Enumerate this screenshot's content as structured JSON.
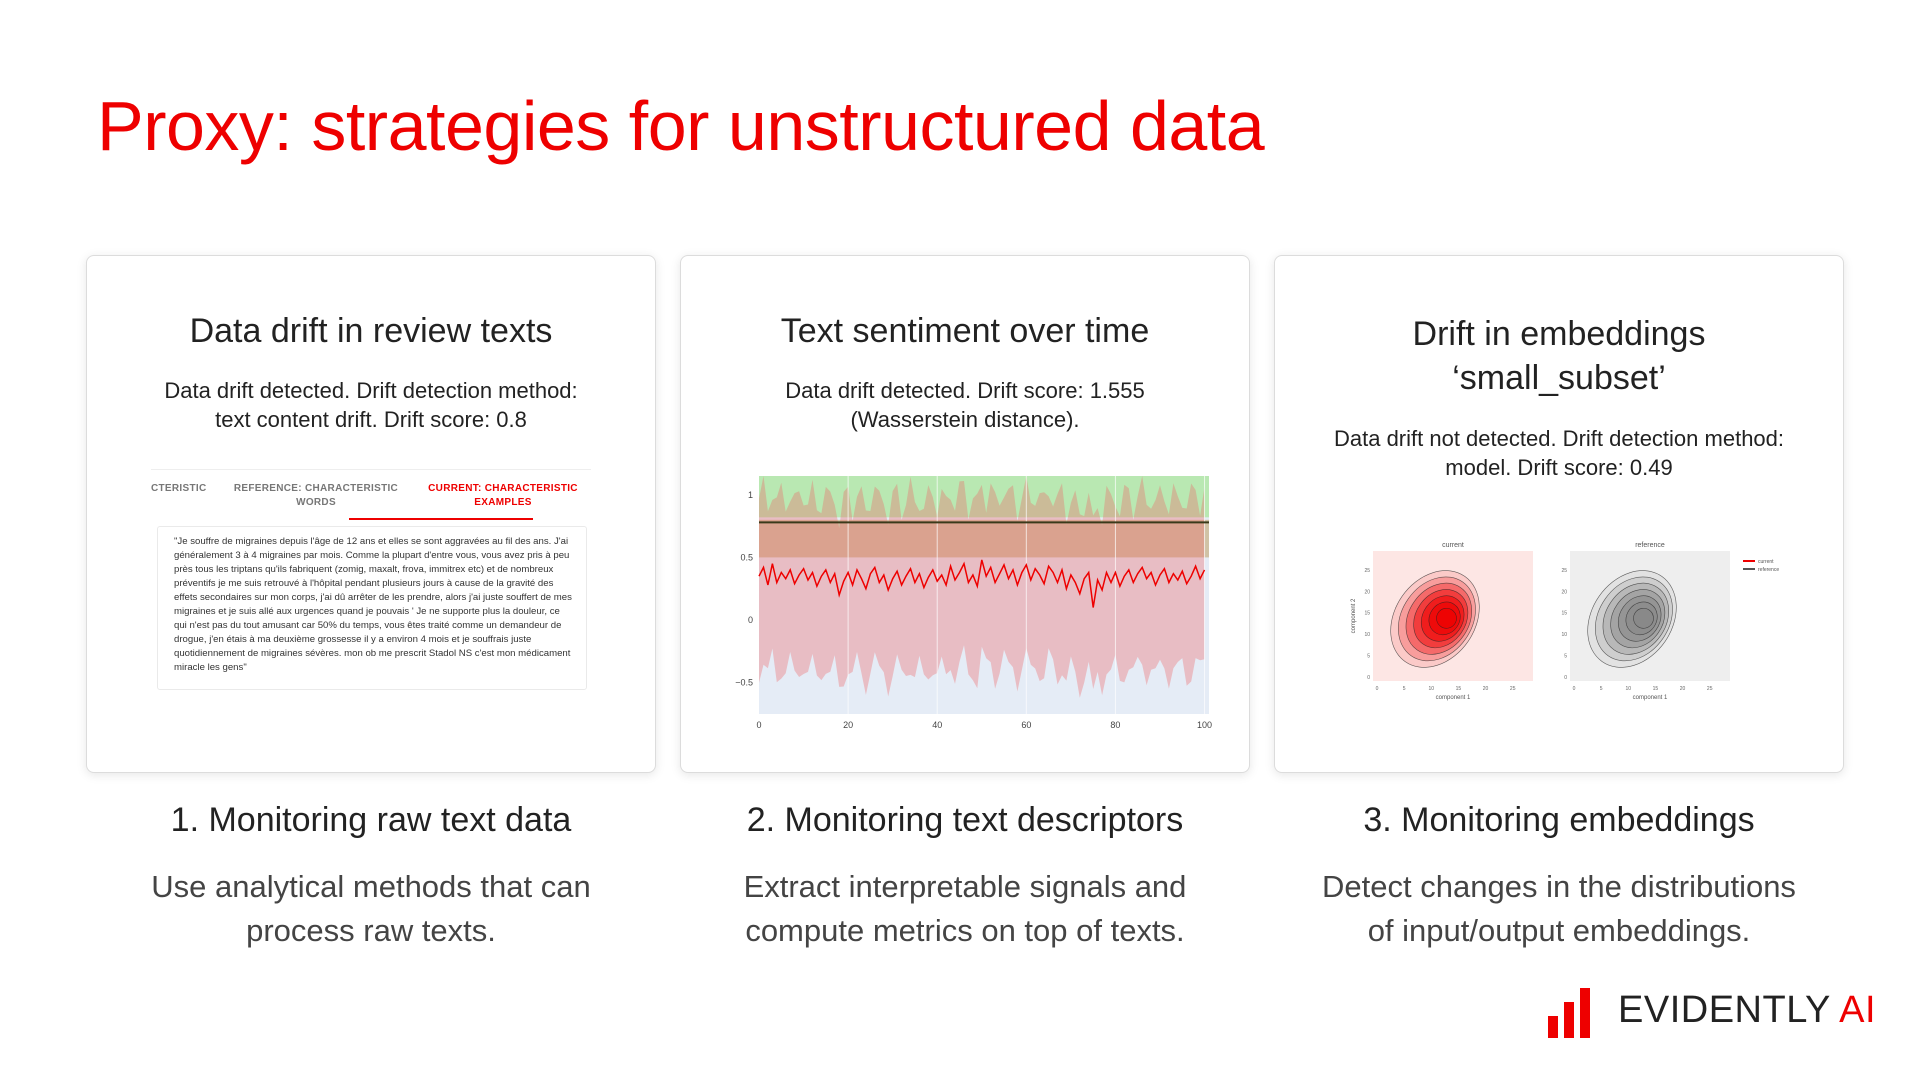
{
  "slide": {
    "title": "Proxy: strategies for unstructured data"
  },
  "cards": [
    {
      "title": "Data drift in review texts",
      "subtitle_line1": "Data drift detected. Drift detection method:",
      "subtitle_line2": "text content drift. Drift score: 0.8",
      "tabs": [
        "CTERISTIC",
        "REFERENCE: CHARACTERISTIC WORDS",
        "CURRENT: CHARACTERISTIC EXAMPLES"
      ],
      "example_text": "\"Je souffre de migraines depuis l'âge de 12 ans et elles se sont aggravées au fil des ans. J'ai généralement 3 à 4 migraines par mois. Comme la plupart d'entre vous, vous avez pris à peu près tous les triptans qu'ils fabriquent (zomig, maxalt, frova, immitrex etc) et de nombreux préventifs je me suis retrouvé à l'hôpital pendant plusieurs jours à cause de la gravité des effets secondaires sur mon corps, j'ai dû arrêter de les prendre, alors j'ai juste souffert de mes migraines et je suis allé aux urgences quand je pouvais ' Je ne supporte plus la douleur, ce qui n'est pas du tout amusant car 50% du temps, vous êtes traité comme un demandeur de drogue, j'en étais à ma deuxième grossesse il y a environ 4 mois et je souffrais juste quotidiennement de migraines sévères. mon ob me prescrit Stadol NS c'est mon médicament miracle les gens\""
    },
    {
      "title": "Text sentiment over time",
      "subtitle_line1": "Data drift detected. Drift score: 1.555",
      "subtitle_line2": "(Wasserstein distance)."
    },
    {
      "title_line1": "Drift in embeddings",
      "title_line2": "‘small_subset’",
      "subtitle_line1": "Data drift not detected. Drift detection method:",
      "subtitle_line2": "model. Drift score: 0.49"
    }
  ],
  "sections": [
    {
      "heading": "1. Monitoring raw text data",
      "desc_line1": "Use analytical methods that can",
      "desc_line2": "process raw texts."
    },
    {
      "heading": "2. Monitoring text descriptors",
      "desc_line1": "Extract interpretable signals and",
      "desc_line2": "compute metrics on top of texts."
    },
    {
      "heading": "3. Monitoring embeddings",
      "desc_line1": "Detect changes in the distributions",
      "desc_line2": "of input/output embeddings."
    }
  ],
  "logo": {
    "text_main": "EVIDENTLY",
    "text_accent": "AI",
    "icon": "bar-chart-logo-icon"
  },
  "colors": {
    "accent": "#ee0000",
    "text": "#222222",
    "muted": "#444444"
  },
  "chart_data": [
    {
      "type": "line",
      "x_ticks": [
        "0",
        "20",
        "40",
        "60",
        "80",
        "100"
      ],
      "y_ticks": [
        "1",
        "0.5",
        "0",
        "−0.5"
      ],
      "xlim": [
        0,
        101
      ],
      "ylim": [
        -0.75,
        1.15
      ],
      "reference_mean": 0.78,
      "bands": {
        "upper_green": [
          0.82,
          1.15
        ],
        "reference_zone": [
          0.5,
          0.8
        ]
      },
      "series": [
        {
          "values": [
            0.35,
            0.42,
            0.28,
            0.45,
            0.3,
            0.38,
            0.33,
            0.4,
            0.29,
            0.36,
            0.41,
            0.32,
            0.38,
            0.27,
            0.35,
            0.4,
            0.3,
            0.37,
            0.2,
            0.31,
            0.38,
            0.28,
            0.4,
            0.33,
            0.25,
            0.37,
            0.42,
            0.3,
            0.36,
            0.24,
            0.33,
            0.39,
            0.28,
            0.35,
            0.41,
            0.3,
            0.37,
            0.26,
            0.34,
            0.4,
            0.31,
            0.36,
            0.28,
            0.43,
            0.32,
            0.38,
            0.45,
            0.3,
            0.36,
            0.27,
            0.48,
            0.35,
            0.42,
            0.3,
            0.37,
            0.44,
            0.33,
            0.4,
            0.28,
            0.38,
            0.44,
            0.32,
            0.41,
            0.36,
            0.29,
            0.43,
            0.38,
            0.3,
            0.4,
            0.25,
            0.36,
            0.3,
            0.21,
            0.33,
            0.38,
            0.1,
            0.32,
            0.24,
            0.38,
            0.3,
            0.38,
            0.27,
            0.35,
            0.4,
            0.3,
            0.37,
            0.42,
            0.33,
            0.38,
            0.28,
            0.36,
            0.41,
            0.3,
            0.37,
            0.32,
            0.39,
            0.29,
            0.35,
            0.43,
            0.33,
            0.4
          ]
        }
      ]
    },
    {
      "type": "heatmap",
      "panels": [
        "current",
        "reference"
      ],
      "legend": [
        "current",
        "reference"
      ],
      "xlabel": "component 1",
      "ylabel": "component 2",
      "x_ticks": [
        "0",
        "5",
        "10",
        "15",
        "20",
        "25"
      ],
      "y_ticks": [
        "0",
        "5",
        "10",
        "15",
        "20",
        "25"
      ]
    }
  ]
}
